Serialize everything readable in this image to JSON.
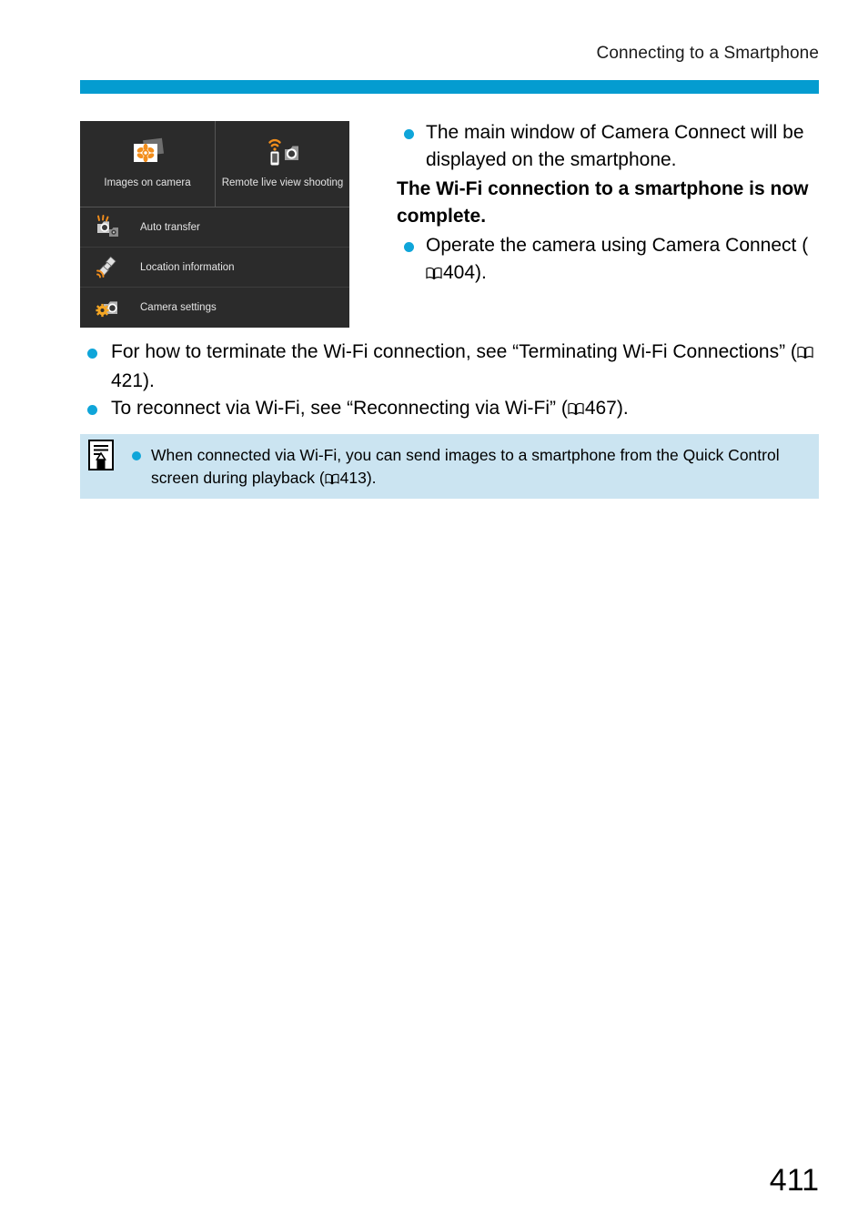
{
  "header": {
    "title": "Connecting to a Smartphone",
    "rule_color": "#049cd0"
  },
  "camera_screen": {
    "tiles": [
      {
        "label": "Images on camera",
        "icon": "images-on-camera-icon"
      },
      {
        "label": "Remote live view shooting",
        "icon": "remote-live-view-icon"
      }
    ],
    "list_items": [
      {
        "label": "Auto transfer",
        "icon": "auto-transfer-icon"
      },
      {
        "label": "Location information",
        "icon": "location-information-icon"
      },
      {
        "label": "Camera settings",
        "icon": "camera-settings-icon"
      }
    ]
  },
  "right_column": {
    "bullet_1": "The main window of Camera Connect will be displayed on the smartphone.",
    "bold_statement": "The Wi-Fi connection to a smartphone is now complete.",
    "bullet_2_pre": "Operate the camera using Camera Connect (",
    "bullet_2_page": "404",
    "bullet_2_post": ")."
  },
  "wide_bullets": [
    {
      "pre": "For how to terminate the Wi-Fi connection, see “Terminating Wi-Fi Connections” (",
      "page": "421",
      "post": ")."
    },
    {
      "pre": "To reconnect via Wi-Fi, see “Reconnecting via Wi-Fi” (",
      "page": "467",
      "post": ")."
    }
  ],
  "note_box": {
    "icon": "note-pencil-icon",
    "background": "#cbe4f1",
    "pre": "When connected via Wi-Fi, you can send images to a smartphone from the Quick Control screen during playback (",
    "page": "413",
    "post": ")."
  },
  "footer": {
    "page_number": "411"
  },
  "colors": {
    "accent_blue": "#0fa5d9",
    "rule_blue": "#049cd0",
    "note_blue": "#cbe4f1",
    "screen_dark": "#2b2b2b",
    "icon_orange": "#f28e1c",
    "icon_gray": "#9a9a9a"
  }
}
